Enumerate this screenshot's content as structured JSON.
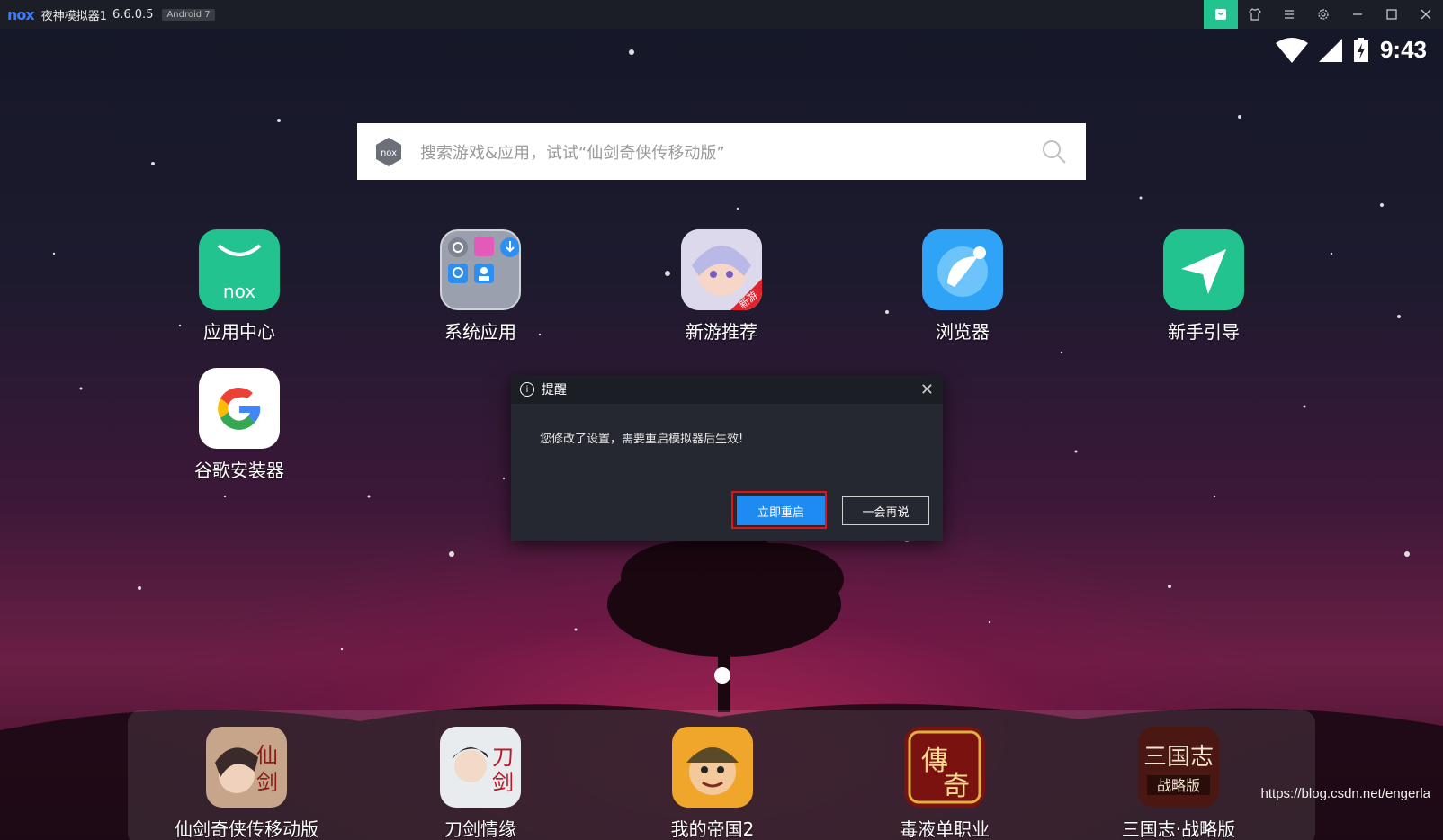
{
  "titlebar": {
    "logo_text": "nox",
    "title": "夜神模拟器1",
    "version": "6.6.0.5",
    "android_badge": "Android 7",
    "icons": [
      "theme-icon",
      "shirt-icon",
      "menu-icon",
      "settings-icon",
      "minimize-icon",
      "maximize-icon",
      "close-icon"
    ]
  },
  "statusbar": {
    "time": "9:43"
  },
  "search": {
    "placeholder": "搜索游戏&应用，试试“仙剑奇侠传移动版”"
  },
  "apps": [
    {
      "label": "应用中心"
    },
    {
      "label": "系统应用"
    },
    {
      "label": "新游推荐"
    },
    {
      "label": "浏览器"
    },
    {
      "label": "新手引导"
    },
    {
      "label": "谷歌安装器"
    }
  ],
  "dialog": {
    "title": "提醒",
    "message": "您修改了设置，需要重启模拟器后生效!",
    "primary_button": "立即重启",
    "secondary_button": "一会再说"
  },
  "dock": [
    {
      "label": "仙剑奇侠传移动版"
    },
    {
      "label": "刀剑情缘"
    },
    {
      "label": "我的帝国2"
    },
    {
      "label": "毒液单职业"
    },
    {
      "label": "三国志·战略版"
    }
  ],
  "watermark": "https://blog.csdn.net/engerla",
  "colors": {
    "accent_green": "#23c38f",
    "button_blue": "#1e8bf2",
    "highlight_red": "#e0151b"
  }
}
